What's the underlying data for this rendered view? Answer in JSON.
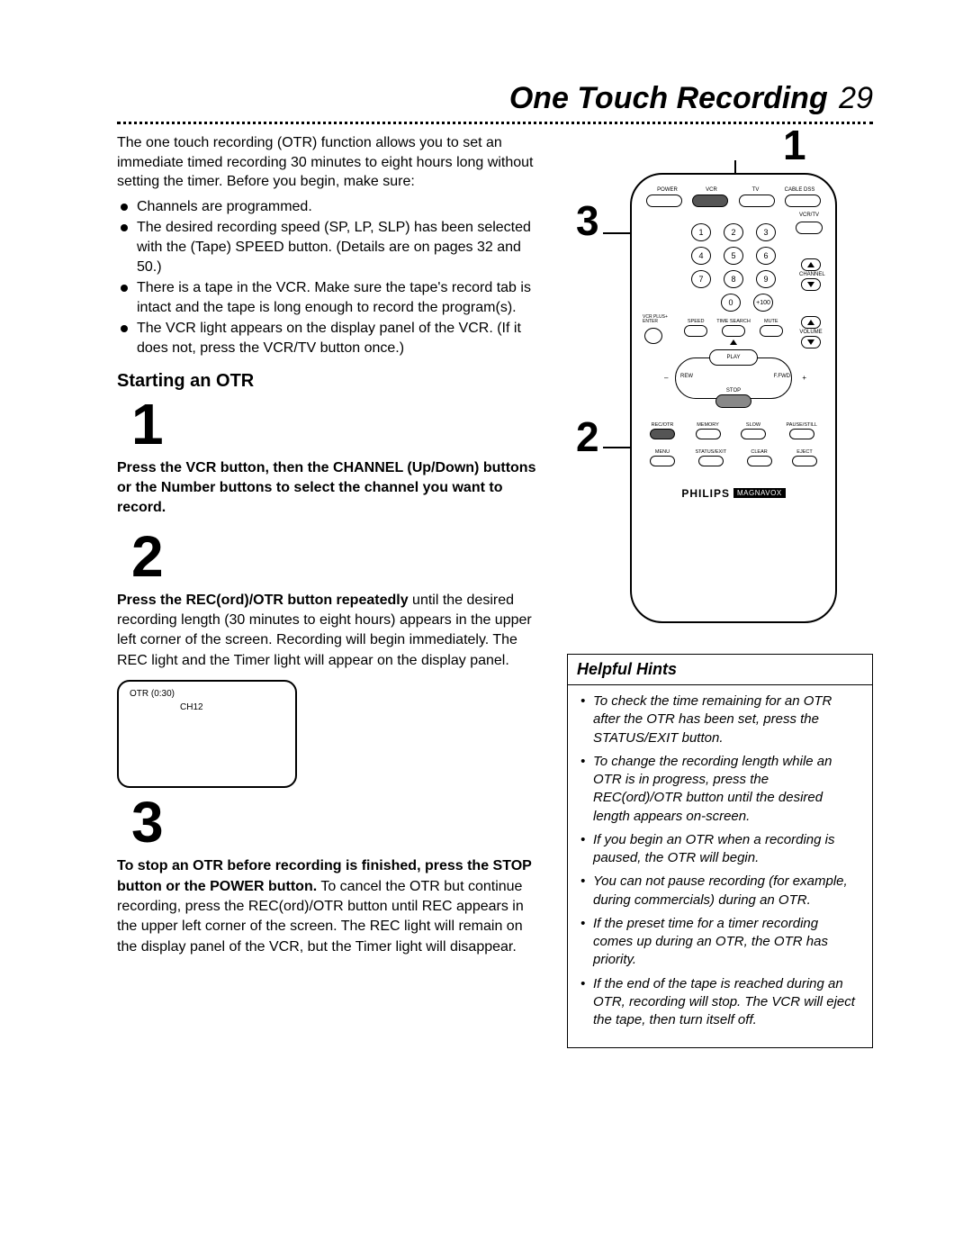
{
  "header": {
    "title": "One Touch Recording",
    "page_number": "29"
  },
  "intro": "The one touch recording (OTR) function allows you to set an immediate timed recording 30 minutes to eight hours long without setting the timer. Before you begin, make sure:",
  "checklist": [
    "Channels are programmed.",
    "The desired recording speed (SP, LP, SLP) has been selected with the (Tape) SPEED button. (Details are on pages 32 and 50.)",
    "There is a tape in the VCR. Make sure the tape's record tab is intact and the tape is long enough to record the program(s).",
    "The VCR light appears on the display panel of the VCR. (If it does not, press the VCR/TV button once.)"
  ],
  "section_heading": "Starting an OTR",
  "steps": {
    "n1": "1",
    "s1_bold": "Press the VCR button, then the CHANNEL (Up/Down) buttons or the Number buttons to select the channel you want to record.",
    "n2": "2",
    "s2_bold": "Press the REC(ord)/OTR button repeatedly",
    "s2_rest": " until the desired recording length (30 minutes to eight hours) appears in the upper left corner of the screen. Recording will begin immediately. The REC light and the Timer light will appear on the display panel.",
    "screen_line1": "OTR (0:30)",
    "screen_line2": "CH12",
    "n3": "3",
    "s3_bold": "To stop an OTR before recording is finished, press the STOP button or the POWER button.",
    "s3_rest": " To cancel the OTR but continue recording, press the REC(ord)/OTR button until REC appears in the upper left corner of the screen. The REC light will remain on the display panel of the VCR, but the Timer light will disappear."
  },
  "callouts": {
    "c1": "1",
    "c2": "2",
    "c3": "3"
  },
  "remote": {
    "top_labels": [
      "POWER",
      "VCR",
      "TV",
      "CABLE DSS"
    ],
    "vcrtv": "VCR/TV",
    "channel": "CHANNEL",
    "volume": "VOLUME",
    "nums": [
      "1",
      "2",
      "3",
      "4",
      "5",
      "6",
      "7",
      "8",
      "9",
      "0",
      "+100"
    ],
    "vcrplus": "VCR PLUS+ ENTER",
    "func_labels": [
      "SPEED",
      "TIME SEARCH",
      "MUTE"
    ],
    "play": "PLAY",
    "rew": "REW",
    "ffwd": "F.FWD",
    "stop": "STOP",
    "bottom_row1": [
      "REC/OTR",
      "MEMORY",
      "SLOW",
      "PAUSE/STILL"
    ],
    "bottom_row2": [
      "MENU",
      "STATUS/EXIT",
      "CLEAR",
      "EJECT"
    ],
    "brand1": "PHILIPS",
    "brand2": "MAGNAVOX"
  },
  "hints": {
    "title": "Helpful Hints",
    "items": [
      "To check the time remaining for an OTR after the OTR has been set, press the STATUS/EXIT button.",
      "To change the recording length while an OTR is in progress, press the REC(ord)/OTR button until the desired length appears on-screen.",
      "If you begin an OTR when a recording is paused, the OTR will begin.",
      "You can not pause recording (for example, during commercials) during an OTR.",
      "If the preset time for a timer recording comes up during an OTR, the OTR has priority.",
      "If the end of the tape is reached during an OTR, recording will stop. The VCR will eject the tape, then turn itself off."
    ]
  }
}
